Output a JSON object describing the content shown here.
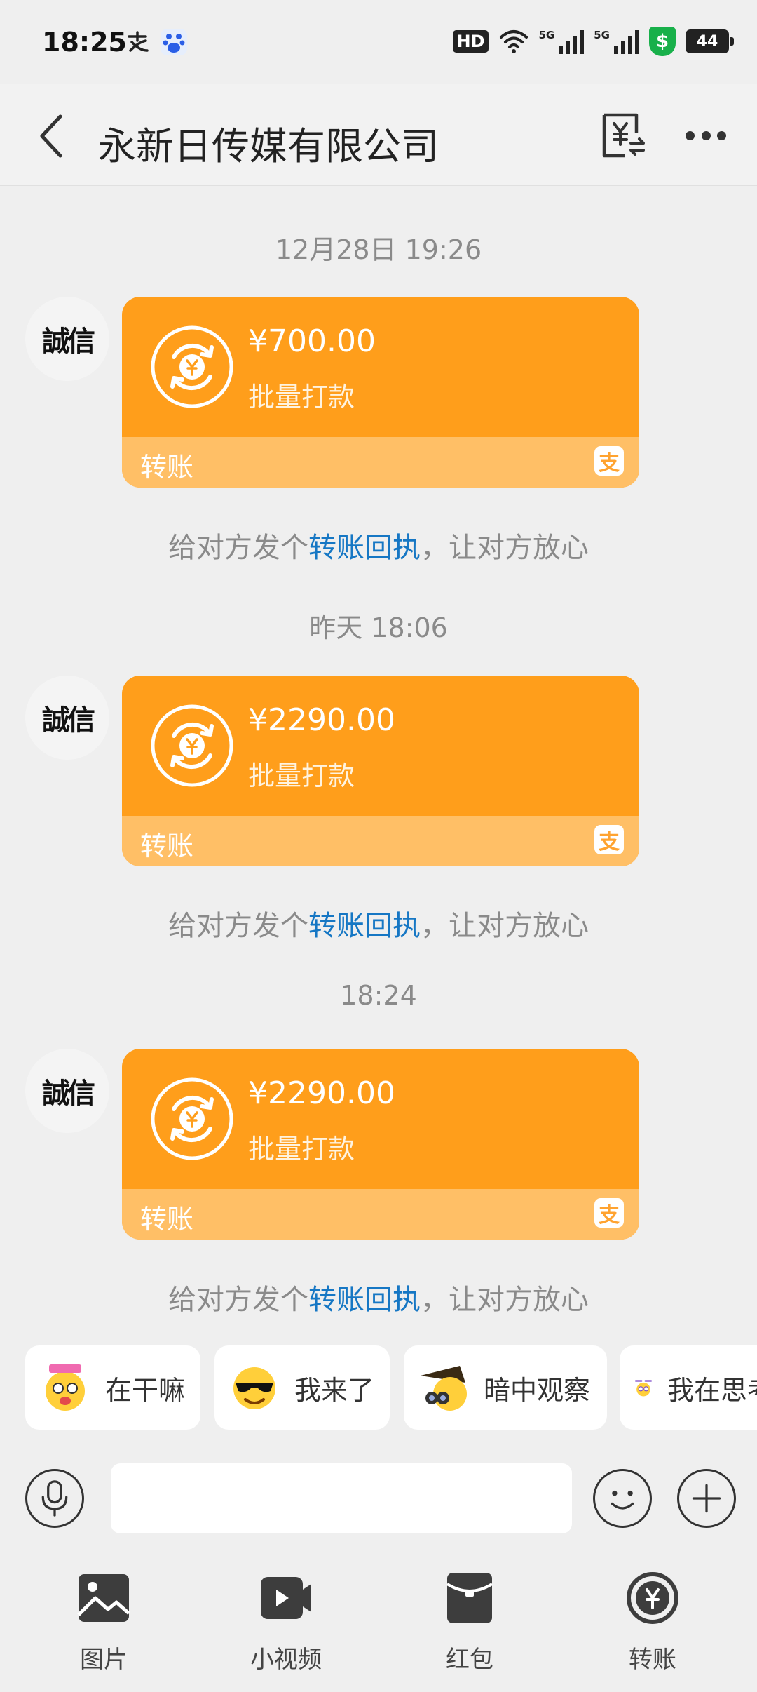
{
  "status_bar": {
    "time": "18:25",
    "app_icons": [
      "alipay-icon",
      "baidu-icon"
    ],
    "hd": "HD",
    "signal_label_1": "5G",
    "signal_label_2": "5G",
    "battery": "44"
  },
  "header": {
    "title": "永新日传媒有限公司",
    "icons": [
      "back-arrow-icon",
      "bill-icon",
      "more-icon"
    ]
  },
  "messages": [
    {
      "timestamp": "12月28日 19:26",
      "amount": "¥700.00",
      "description": "批量打款",
      "type_label": "转账",
      "alipay_badge": "支",
      "avatar_text": "誠信"
    },
    {
      "timestamp": "昨天 18:06",
      "amount": "¥2290.00",
      "description": "批量打款",
      "type_label": "转账",
      "alipay_badge": "支",
      "avatar_text": "誠信"
    },
    {
      "timestamp": "18:24",
      "amount": "¥2290.00",
      "description": "批量打款",
      "type_label": "转账",
      "alipay_badge": "支",
      "avatar_text": "誠信"
    }
  ],
  "receipt_hint": {
    "prefix": "给对方发个",
    "link": "转账回执",
    "suffix": "，让对方放心"
  },
  "quick_replies": [
    {
      "label": "在干嘛",
      "icon": "sticker-busy-icon"
    },
    {
      "label": "我来了",
      "icon": "sticker-sunglasses-icon"
    },
    {
      "label": "暗中观察",
      "icon": "sticker-observe-icon"
    },
    {
      "label": "我在思考",
      "icon": "sticker-thinking-icon"
    }
  ],
  "input": {
    "placeholder": "",
    "value": ""
  },
  "toolbar": [
    {
      "label": "图片",
      "icon": "image-icon"
    },
    {
      "label": "小视频",
      "icon": "video-icon"
    },
    {
      "label": "红包",
      "icon": "red-packet-icon"
    },
    {
      "label": "转账",
      "icon": "transfer-icon"
    }
  ],
  "colors": {
    "card": "#ff9e1b",
    "card_footer": "#ffbf66",
    "link": "#1677c4",
    "background": "#efefef"
  }
}
